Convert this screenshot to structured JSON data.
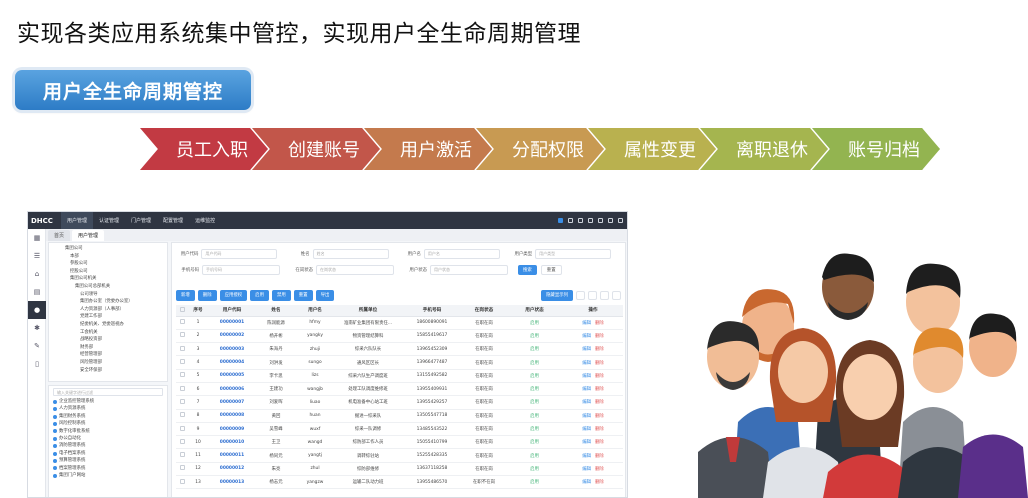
{
  "headline": "实现各类应用系统集中管控，实现用户全生命周期管理",
  "badge": "用户全生命周期管控",
  "steps": [
    {
      "label": "员工入职",
      "color": "#c23a43"
    },
    {
      "label": "创建账号",
      "color": "#c2564a"
    },
    {
      "label": "用户激活",
      "color": "#c47a4d"
    },
    {
      "label": "分配权限",
      "color": "#c89a52"
    },
    {
      "label": "属性变更",
      "color": "#b9b14f"
    },
    {
      "label": "离职退休",
      "color": "#a5b54f"
    },
    {
      "label": "账号归档",
      "color": "#93b450"
    }
  ],
  "app": {
    "logo": "DHCC",
    "menu": [
      {
        "label": "用户管理",
        "active": true
      },
      {
        "label": "认证管理",
        "active": false
      },
      {
        "label": "门户管理",
        "active": false
      },
      {
        "label": "配置管理",
        "active": false
      },
      {
        "label": "运维监控",
        "active": false
      }
    ],
    "tabs": [
      {
        "label": "首页",
        "active": false
      },
      {
        "label": "用户管理",
        "active": true
      }
    ],
    "tree": [
      "集团公司",
      "本部",
      "参股公司",
      "控股公司",
      "集团公司机关",
      "集团公司总部机关",
      "公司领导",
      "集团办公室（党委办公室）",
      "人力资源部（人事部）",
      "党建工作部",
      "纪委机关、党委巡视办",
      "工会机关",
      "战略投资部",
      "财务部",
      "经营管理部",
      "风险管理部",
      "安全环保部"
    ],
    "apps_search": "输入关键字进行过滤",
    "apps": [
      "企业监控管理系统",
      "人力资源系统",
      "集团财务系统",
      "风险控制系统",
      "数字化审批系统",
      "办公自动化",
      "消防管理系统",
      "电子档案系统",
      "预算管理系统",
      "档案管理系统",
      "集团门户网站"
    ],
    "filters": {
      "row1": [
        {
          "label": "用户代码",
          "placeholder": "用户代码"
        },
        {
          "label": "姓名",
          "placeholder": "姓名"
        },
        {
          "label": "用户名",
          "placeholder": "用户名"
        },
        {
          "label": "用户类型",
          "placeholder": "用户类型"
        }
      ],
      "row2": [
        {
          "label": "手机号码",
          "placeholder": "手机号码"
        },
        {
          "label": "在岗状态",
          "placeholder": "在岗状态"
        },
        {
          "label": "用户状态",
          "placeholder": "用户状态"
        }
      ],
      "search": "搜索",
      "reset": "重置"
    },
    "toolbar": [
      "新增",
      "删除",
      "应用授权",
      "启用",
      "禁用",
      "重置",
      "导出"
    ],
    "column_toggle": "隐藏显示列",
    "columns": [
      "序号",
      "用户代码",
      "姓名",
      "用户名",
      "所属单位",
      "手机号码",
      "在岗状态",
      "用户状态",
      "操作"
    ],
    "op_edit": "编辑",
    "op_del": "删除",
    "rows": [
      [
        "1",
        "00000001",
        "陈润能源",
        "hfmy",
        "淮南矿业集团有限责任...",
        "18600890091",
        "在职在岗",
        "启用"
      ],
      [
        "2",
        "00000002",
        "杨开彬",
        "yangky",
        "物资管理结算科",
        "15855419617",
        "在职在岗",
        "启用"
      ],
      [
        "3",
        "00000003",
        "朱海丹",
        "zhuji",
        "综采六队队长",
        "13965452309",
        "在职在岗",
        "启用"
      ],
      [
        "4",
        "00000004",
        "刘洪发",
        "sungo",
        "通风区区长",
        "13966477487",
        "在职在岗",
        "启用"
      ],
      [
        "5",
        "00000005",
        "李卡思",
        "lizs",
        "综采六队生产调度班",
        "13155492582",
        "在职在岗",
        "启用"
      ],
      [
        "6",
        "00000006",
        "王建功",
        "wangjb",
        "处理工队调度维修班",
        "13955409931",
        "在职在岗",
        "启用"
      ],
      [
        "7",
        "00000007",
        "刘爱晖",
        "liuao",
        "机电准备中心站工班",
        "13955429257",
        "在职在岗",
        "启用"
      ],
      [
        "8",
        "00000008",
        "黄回",
        "huan",
        "掘进一综采队",
        "13505547718",
        "在职在岗",
        "启用"
      ],
      [
        "9",
        "00000009",
        "吴雪峰",
        "wuxf",
        "综采一队调修",
        "13485543522",
        "在职在岗",
        "启用"
      ],
      [
        "10",
        "00000010",
        "王卫",
        "wangd",
        "综防部工作人员",
        "15055410799",
        "在职在岗",
        "启用"
      ],
      [
        "11",
        "00000011",
        "杨同元",
        "yangtj",
        "调转综驻站",
        "15255428335",
        "在职在岗",
        "启用"
      ],
      [
        "12",
        "00000012",
        "朱亮",
        "zhul",
        "综防部维修",
        "13637118258",
        "在职在岗",
        "启用"
      ],
      [
        "13",
        "00000013",
        "杨志元",
        "yangzw",
        "运输二队动力班",
        "13955486570",
        "在职不在岗",
        "启用"
      ]
    ]
  }
}
